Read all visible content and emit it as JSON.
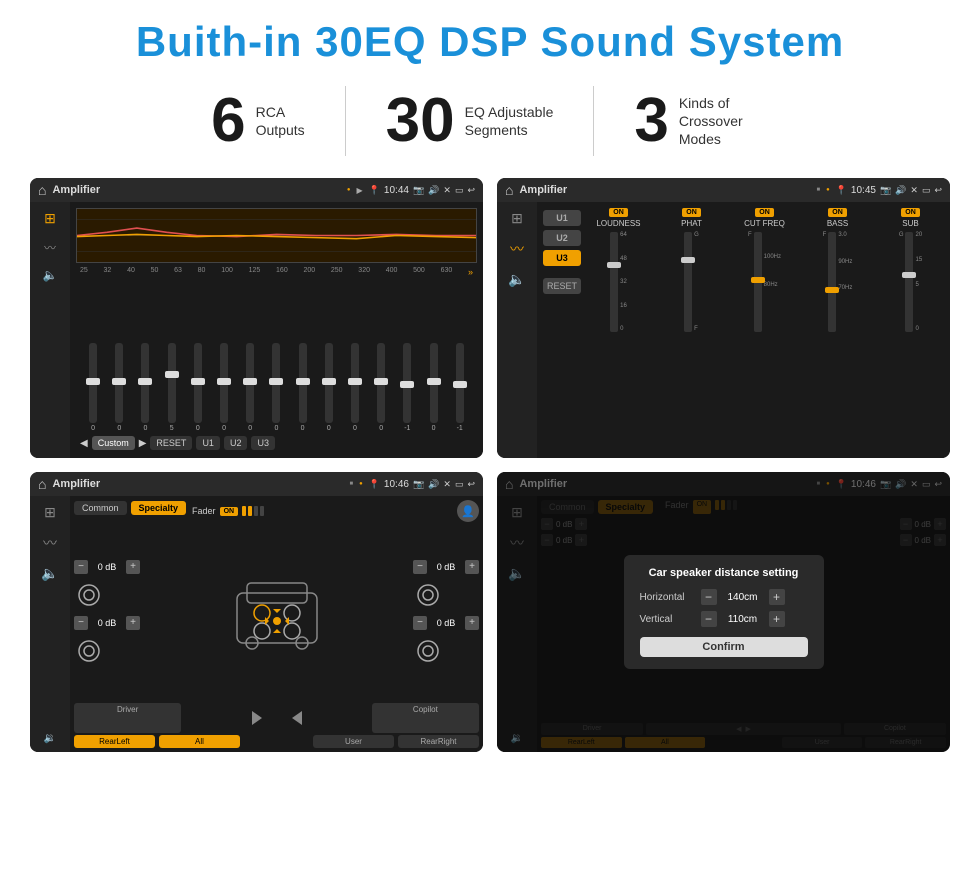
{
  "header": {
    "title": "Buith-in 30EQ DSP Sound System"
  },
  "stats": [
    {
      "number": "6",
      "text_line1": "RCA",
      "text_line2": "Outputs"
    },
    {
      "number": "30",
      "text_line1": "EQ Adjustable",
      "text_line2": "Segments"
    },
    {
      "number": "3",
      "text_line1": "Kinds of",
      "text_line2": "Crossover Modes"
    }
  ],
  "screens": {
    "screen1": {
      "title": "Amplifier",
      "time": "10:44",
      "freqs": [
        "25",
        "32",
        "40",
        "50",
        "63",
        "80",
        "100",
        "125",
        "160",
        "200",
        "250",
        "320",
        "400",
        "500",
        "630"
      ],
      "values": [
        "0",
        "0",
        "0",
        "5",
        "0",
        "0",
        "0",
        "0",
        "0",
        "0",
        "0",
        "0",
        "-1",
        "0",
        "-1"
      ],
      "bottom_labels": [
        "Custom",
        "RESET",
        "U1",
        "U2",
        "U3"
      ]
    },
    "screen2": {
      "title": "Amplifier",
      "time": "10:45",
      "presets": [
        "U1",
        "U2",
        "U3"
      ],
      "controls": [
        "LOUDNESS",
        "PHAT",
        "CUT FREQ",
        "BASS",
        "SUB"
      ],
      "reset": "RESET"
    },
    "screen3": {
      "title": "Amplifier",
      "time": "10:46",
      "tabs": [
        "Common",
        "Specialty"
      ],
      "fader_label": "Fader",
      "fader_on": "ON",
      "db_values": [
        "0 dB",
        "0 dB",
        "0 dB",
        "0 dB"
      ],
      "buttons": [
        "Driver",
        "Copilot",
        "RearLeft",
        "All",
        "User",
        "RearRight"
      ]
    },
    "screen4": {
      "title": "Amplifier",
      "time": "10:46",
      "tabs": [
        "Common",
        "Specialty"
      ],
      "dialog": {
        "title": "Car speaker distance setting",
        "horizontal_label": "Horizontal",
        "horizontal_value": "140cm",
        "vertical_label": "Vertical",
        "vertical_value": "110cm",
        "confirm_label": "Confirm",
        "db_values": [
          "0 dB",
          "0 dB"
        ]
      },
      "buttons": [
        "Driver",
        "Copilot",
        "RearLeft",
        "User",
        "RearRight"
      ]
    }
  }
}
